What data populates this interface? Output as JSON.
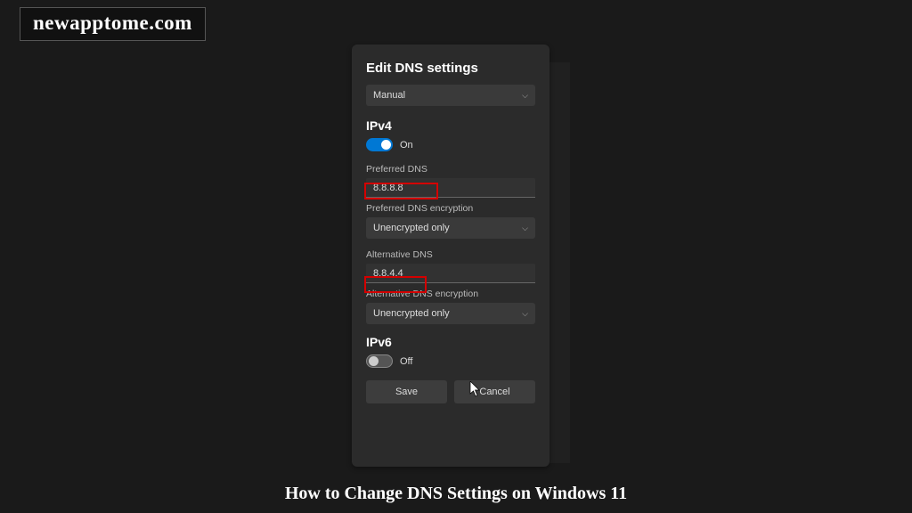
{
  "watermark": "newapptome.com",
  "caption": "How to Change DNS Settings on Windows 11",
  "dialog": {
    "title": "Edit DNS settings",
    "mode_select": "Manual",
    "ipv4": {
      "title": "IPv4",
      "toggle_state": "On",
      "preferred_label": "Preferred DNS",
      "preferred_value": "8.8.8.8",
      "preferred_enc_label": "Preferred DNS encryption",
      "preferred_enc_value": "Unencrypted only",
      "alt_label": "Alternative DNS",
      "alt_value": "8.8.4.4",
      "alt_enc_label": "Alternative DNS encryption",
      "alt_enc_value": "Unencrypted only"
    },
    "ipv6": {
      "title": "IPv6",
      "toggle_state": "Off"
    },
    "save_label": "Save",
    "cancel_label": "Cancel"
  }
}
